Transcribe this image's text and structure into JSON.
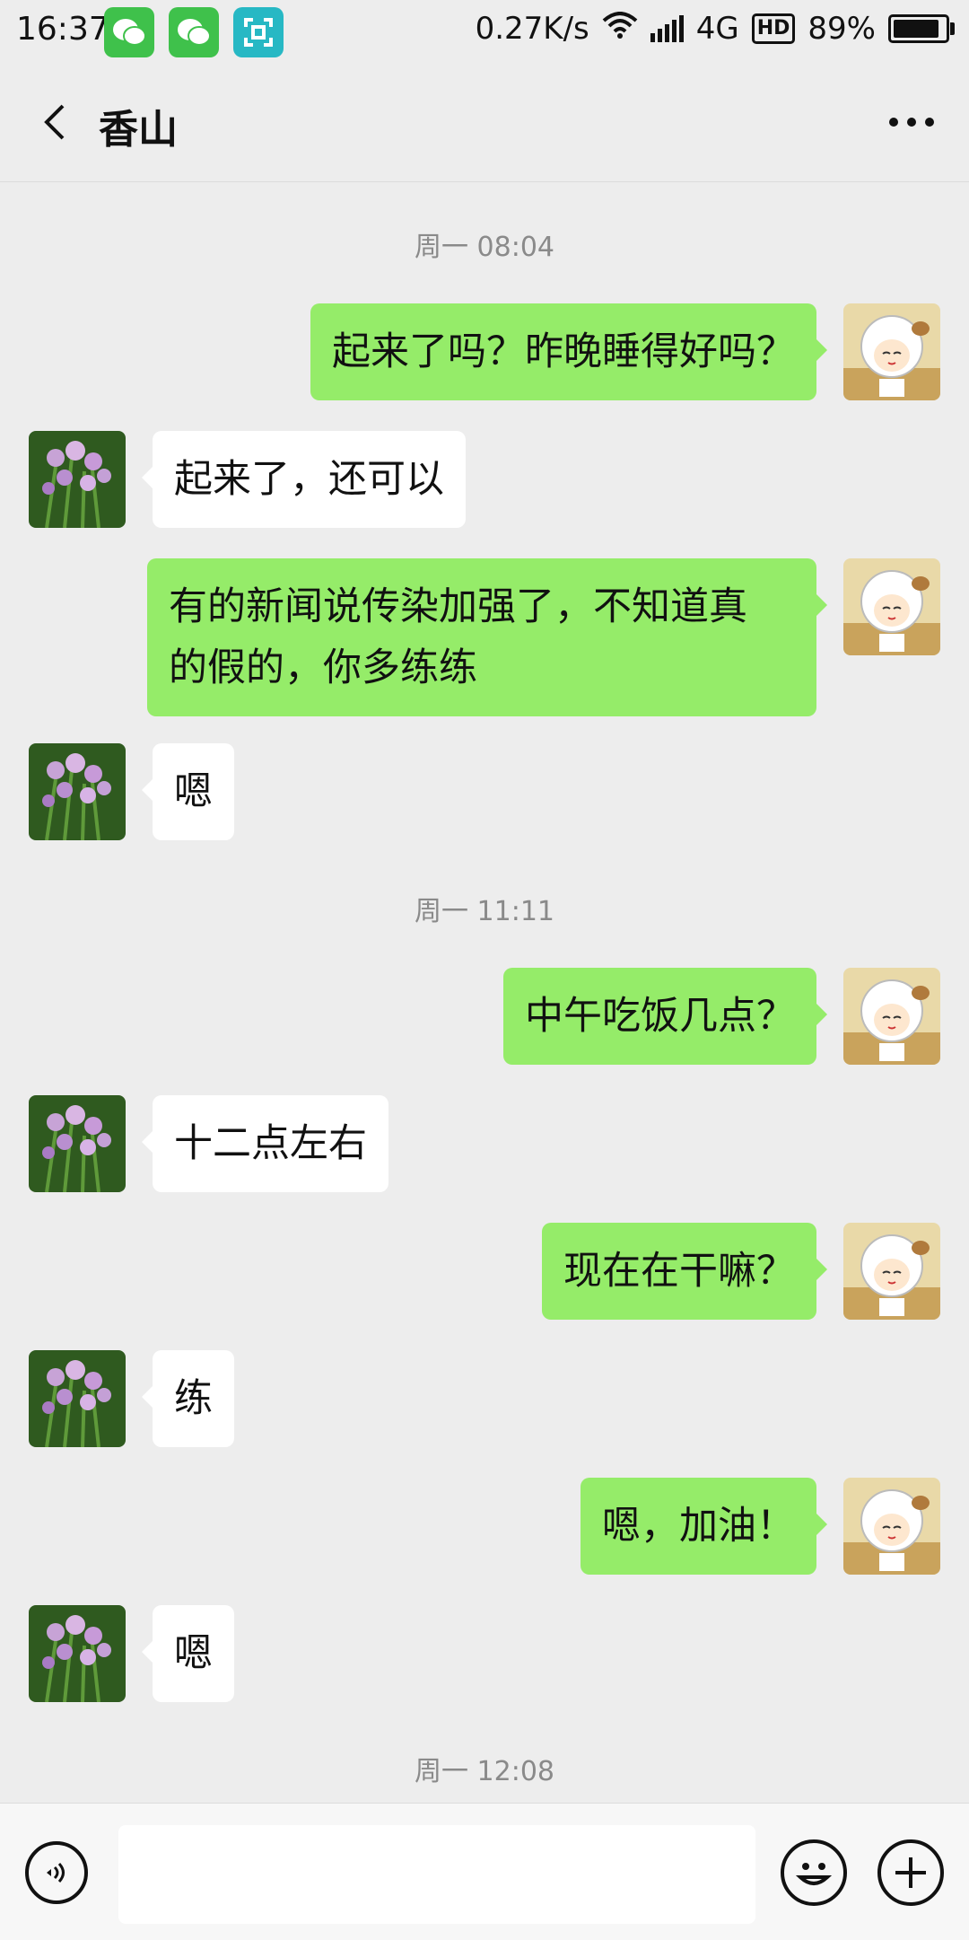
{
  "status_bar": {
    "time": "16:37",
    "network_speed": "0.27K/s",
    "network_type": "4G",
    "hd_label": "HD",
    "battery_percent": "89%",
    "battery_level": 0.89,
    "app_icons": [
      "wechat-icon",
      "wechat-icon",
      "scan-icon"
    ]
  },
  "header": {
    "title": "香山",
    "back_icon": "chevron-left-icon",
    "more_icon": "more-dots-icon"
  },
  "chat": {
    "timestamps": [
      "周一 08:04",
      "周一 11:11",
      "周一 12:08"
    ],
    "messages": [
      {
        "side": "right",
        "text": "起来了吗？昨晚睡得好吗？"
      },
      {
        "side": "left",
        "text": "起来了，还可以"
      },
      {
        "side": "right",
        "text": "有的新闻说传染加强了，不知道真\n的假的，你多练练"
      },
      {
        "side": "left",
        "text": "嗯"
      },
      {
        "side": "right",
        "text": "中午吃饭几点？"
      },
      {
        "side": "left",
        "text": "十二点左右"
      },
      {
        "side": "right",
        "text": "现在在干嘛？"
      },
      {
        "side": "left",
        "text": "练"
      },
      {
        "side": "right",
        "text": "嗯，加油！"
      },
      {
        "side": "left",
        "text": "嗯"
      }
    ]
  },
  "input_bar": {
    "voice_icon": "voice-icon",
    "input_value": "",
    "emoji_icon": "emoji-icon",
    "plus_icon": "plus-icon"
  },
  "colors": {
    "background": "#ededed",
    "sent_bubble": "#95ec69",
    "received_bubble": "#ffffff",
    "timestamp": "#8a8a8a"
  }
}
